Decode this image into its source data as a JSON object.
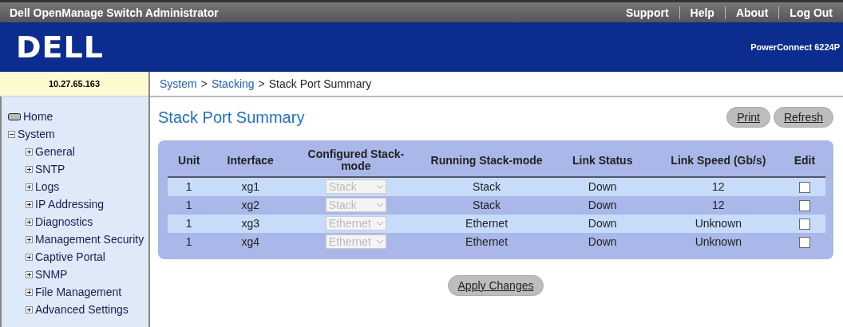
{
  "top_bar": {
    "title": "Dell OpenManage Switch Administrator",
    "links": [
      "Support",
      "Help",
      "About",
      "Log Out"
    ]
  },
  "header": {
    "logo": "DELL",
    "model": "PowerConnect 6224P"
  },
  "address": "10.27.65.163",
  "breadcrumb": {
    "links": [
      "System",
      "Stacking"
    ],
    "separators": [
      ">",
      ">"
    ],
    "current": "Stack Port Summary"
  },
  "sidebar": {
    "items": [
      {
        "label": "Home",
        "kind": "home"
      },
      {
        "label": "System",
        "kind": "folder",
        "expanded": true,
        "children": [
          {
            "label": "General",
            "expanded": false
          },
          {
            "label": "SNTP",
            "expanded": false
          },
          {
            "label": "Logs",
            "expanded": false
          },
          {
            "label": "IP Addressing",
            "expanded": false
          },
          {
            "label": "Diagnostics",
            "expanded": false
          },
          {
            "label": "Management Security",
            "expanded": false
          },
          {
            "label": "Captive Portal",
            "expanded": false
          },
          {
            "label": "SNMP",
            "expanded": false
          },
          {
            "label": "File Management",
            "expanded": false
          },
          {
            "label": "Advanced Settings",
            "expanded": false
          }
        ]
      }
    ]
  },
  "page": {
    "title": "Stack Port Summary",
    "buttons": [
      "Print",
      "Refresh"
    ]
  },
  "table": {
    "columns": [
      "Unit",
      "Interface",
      "Configured Stack-mode",
      "Running Stack-mode",
      "Link Status",
      "Link Speed (Gb/s)",
      "Edit"
    ],
    "rows": [
      {
        "unit": "1",
        "interface": "xg1",
        "configured": "Stack",
        "configured_disabled": true,
        "running": "Stack",
        "status": "Down",
        "speed": "12",
        "edit_checked": false
      },
      {
        "unit": "1",
        "interface": "xg2",
        "configured": "Stack",
        "configured_disabled": true,
        "running": "Stack",
        "status": "Down",
        "speed": "12",
        "edit_checked": false
      },
      {
        "unit": "1",
        "interface": "xg3",
        "configured": "Ethernet",
        "configured_disabled": true,
        "running": "Ethernet",
        "status": "Down",
        "speed": "Unknown",
        "edit_checked": false
      },
      {
        "unit": "1",
        "interface": "xg4",
        "configured": "Ethernet",
        "configured_disabled": true,
        "running": "Ethernet",
        "status": "Down",
        "speed": "Unknown",
        "edit_checked": false
      }
    ]
  },
  "apply_button": "Apply Changes"
}
